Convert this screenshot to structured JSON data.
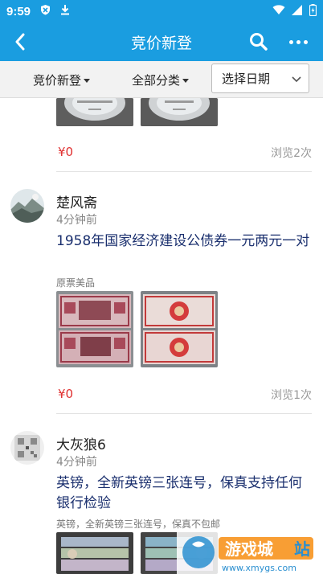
{
  "status": {
    "time": "9:59"
  },
  "appbar": {
    "title": "竞价新登"
  },
  "filters": {
    "f1": "竞价新登",
    "f2": "全部分类",
    "date_placeholder": "选择日期"
  },
  "prev_item": {
    "price": "¥0",
    "views": "浏览2次"
  },
  "items": [
    {
      "user": "楚风斋",
      "time": "4分钟前",
      "title": "1958年国家经济建设公债券一元两元一对",
      "desc": "原票美品",
      "price": "¥0",
      "views": "浏览1次"
    },
    {
      "user": "大灰狼6",
      "time": "4分钟前",
      "title": "英镑，全新英镑三张连号，保真支持任何银行检验",
      "desc": "英镑，全新英镑三张连号，保真不包邮"
    }
  ],
  "watermark": {
    "text": "游戏城",
    "site": "www.xmygs.com",
    "tag": "站"
  },
  "colors": {
    "primary": "#1a9de0",
    "price": "#e03030",
    "title": "#1a2f6e"
  }
}
